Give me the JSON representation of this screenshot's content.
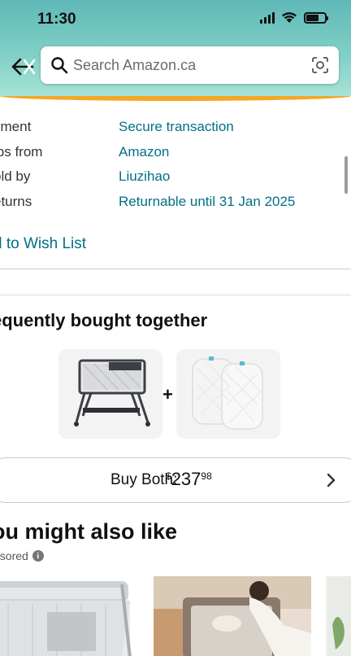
{
  "status_bar": {
    "time": "11:30"
  },
  "search": {
    "placeholder": "Search Amazon.ca"
  },
  "details": [
    {
      "label": "yment",
      "value": "Secure transaction"
    },
    {
      "label": "ips from",
      "value": "Amazon"
    },
    {
      "label": "old by",
      "value": "Liuzihao"
    },
    {
      "label": "eturns",
      "value": "Returnable until 31 Jan 2025"
    }
  ],
  "wishlist_link": "d to Wish List",
  "frequently_bought": {
    "title": "equently bought together",
    "items": [
      {
        "name": "bassinet-product-image",
        "icon": "bassinet"
      },
      {
        "name": "mattress-pads-product-image",
        "icon": "mattress-pads"
      }
    ],
    "plus": "+",
    "buy_both_label": "Buy Both:",
    "price_symbol": "$",
    "price_whole": "237",
    "price_fraction": "98"
  },
  "recommendations": {
    "title": "ou might also like",
    "sponsored_label": "nsored",
    "info_icon_glyph": "i"
  },
  "colors": {
    "link": "#007185",
    "header_gradient_top": "#5fb8b7",
    "header_gradient_bottom": "#a6e3d6",
    "accent_line": "#f5a623"
  }
}
